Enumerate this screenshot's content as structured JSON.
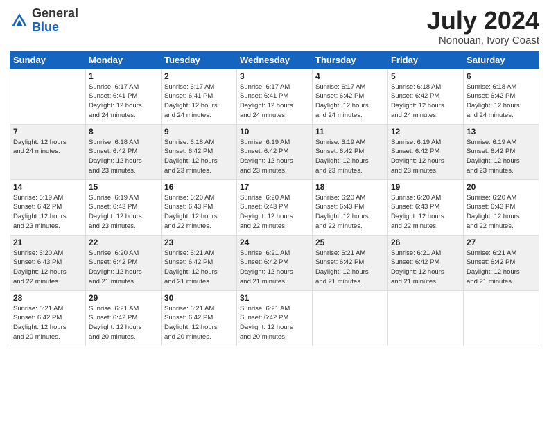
{
  "logo": {
    "general": "General",
    "blue": "Blue"
  },
  "title": "July 2024",
  "location": "Nonouan, Ivory Coast",
  "days_of_week": [
    "Sunday",
    "Monday",
    "Tuesday",
    "Wednesday",
    "Thursday",
    "Friday",
    "Saturday"
  ],
  "weeks": [
    [
      {
        "day": "",
        "info": ""
      },
      {
        "day": "1",
        "info": "Sunrise: 6:17 AM\nSunset: 6:41 PM\nDaylight: 12 hours\nand 24 minutes."
      },
      {
        "day": "2",
        "info": "Sunrise: 6:17 AM\nSunset: 6:41 PM\nDaylight: 12 hours\nand 24 minutes."
      },
      {
        "day": "3",
        "info": "Sunrise: 6:17 AM\nSunset: 6:41 PM\nDaylight: 12 hours\nand 24 minutes."
      },
      {
        "day": "4",
        "info": "Sunrise: 6:17 AM\nSunset: 6:42 PM\nDaylight: 12 hours\nand 24 minutes."
      },
      {
        "day": "5",
        "info": "Sunrise: 6:18 AM\nSunset: 6:42 PM\nDaylight: 12 hours\nand 24 minutes."
      },
      {
        "day": "6",
        "info": "Sunrise: 6:18 AM\nSunset: 6:42 PM\nDaylight: 12 hours\nand 24 minutes."
      }
    ],
    [
      {
        "day": "7",
        "info": "Daylight: 12 hours\nand 24 minutes."
      },
      {
        "day": "8",
        "info": "Sunrise: 6:18 AM\nSunset: 6:42 PM\nDaylight: 12 hours\nand 23 minutes."
      },
      {
        "day": "9",
        "info": "Sunrise: 6:18 AM\nSunset: 6:42 PM\nDaylight: 12 hours\nand 23 minutes."
      },
      {
        "day": "10",
        "info": "Sunrise: 6:19 AM\nSunset: 6:42 PM\nDaylight: 12 hours\nand 23 minutes."
      },
      {
        "day": "11",
        "info": "Sunrise: 6:19 AM\nSunset: 6:42 PM\nDaylight: 12 hours\nand 23 minutes."
      },
      {
        "day": "12",
        "info": "Sunrise: 6:19 AM\nSunset: 6:42 PM\nDaylight: 12 hours\nand 23 minutes."
      },
      {
        "day": "13",
        "info": "Sunrise: 6:19 AM\nSunset: 6:42 PM\nDaylight: 12 hours\nand 23 minutes."
      }
    ],
    [
      {
        "day": "14",
        "info": "Sunrise: 6:19 AM\nSunset: 6:42 PM\nDaylight: 12 hours\nand 23 minutes."
      },
      {
        "day": "15",
        "info": "Sunrise: 6:19 AM\nSunset: 6:43 PM\nDaylight: 12 hours\nand 23 minutes."
      },
      {
        "day": "16",
        "info": "Sunrise: 6:20 AM\nSunset: 6:43 PM\nDaylight: 12 hours\nand 22 minutes."
      },
      {
        "day": "17",
        "info": "Sunrise: 6:20 AM\nSunset: 6:43 PM\nDaylight: 12 hours\nand 22 minutes."
      },
      {
        "day": "18",
        "info": "Sunrise: 6:20 AM\nSunset: 6:43 PM\nDaylight: 12 hours\nand 22 minutes."
      },
      {
        "day": "19",
        "info": "Sunrise: 6:20 AM\nSunset: 6:43 PM\nDaylight: 12 hours\nand 22 minutes."
      },
      {
        "day": "20",
        "info": "Sunrise: 6:20 AM\nSunset: 6:43 PM\nDaylight: 12 hours\nand 22 minutes."
      }
    ],
    [
      {
        "day": "21",
        "info": "Sunrise: 6:20 AM\nSunset: 6:43 PM\nDaylight: 12 hours\nand 22 minutes."
      },
      {
        "day": "22",
        "info": "Sunrise: 6:20 AM\nSunset: 6:42 PM\nDaylight: 12 hours\nand 21 minutes."
      },
      {
        "day": "23",
        "info": "Sunrise: 6:21 AM\nSunset: 6:42 PM\nDaylight: 12 hours\nand 21 minutes."
      },
      {
        "day": "24",
        "info": "Sunrise: 6:21 AM\nSunset: 6:42 PM\nDaylight: 12 hours\nand 21 minutes."
      },
      {
        "day": "25",
        "info": "Sunrise: 6:21 AM\nSunset: 6:42 PM\nDaylight: 12 hours\nand 21 minutes."
      },
      {
        "day": "26",
        "info": "Sunrise: 6:21 AM\nSunset: 6:42 PM\nDaylight: 12 hours\nand 21 minutes."
      },
      {
        "day": "27",
        "info": "Sunrise: 6:21 AM\nSunset: 6:42 PM\nDaylight: 12 hours\nand 21 minutes."
      }
    ],
    [
      {
        "day": "28",
        "info": "Sunrise: 6:21 AM\nSunset: 6:42 PM\nDaylight: 12 hours\nand 20 minutes."
      },
      {
        "day": "29",
        "info": "Sunrise: 6:21 AM\nSunset: 6:42 PM\nDaylight: 12 hours\nand 20 minutes."
      },
      {
        "day": "30",
        "info": "Sunrise: 6:21 AM\nSunset: 6:42 PM\nDaylight: 12 hours\nand 20 minutes."
      },
      {
        "day": "31",
        "info": "Sunrise: 6:21 AM\nSunset: 6:42 PM\nDaylight: 12 hours\nand 20 minutes."
      },
      {
        "day": "",
        "info": ""
      },
      {
        "day": "",
        "info": ""
      },
      {
        "day": "",
        "info": ""
      }
    ]
  ]
}
